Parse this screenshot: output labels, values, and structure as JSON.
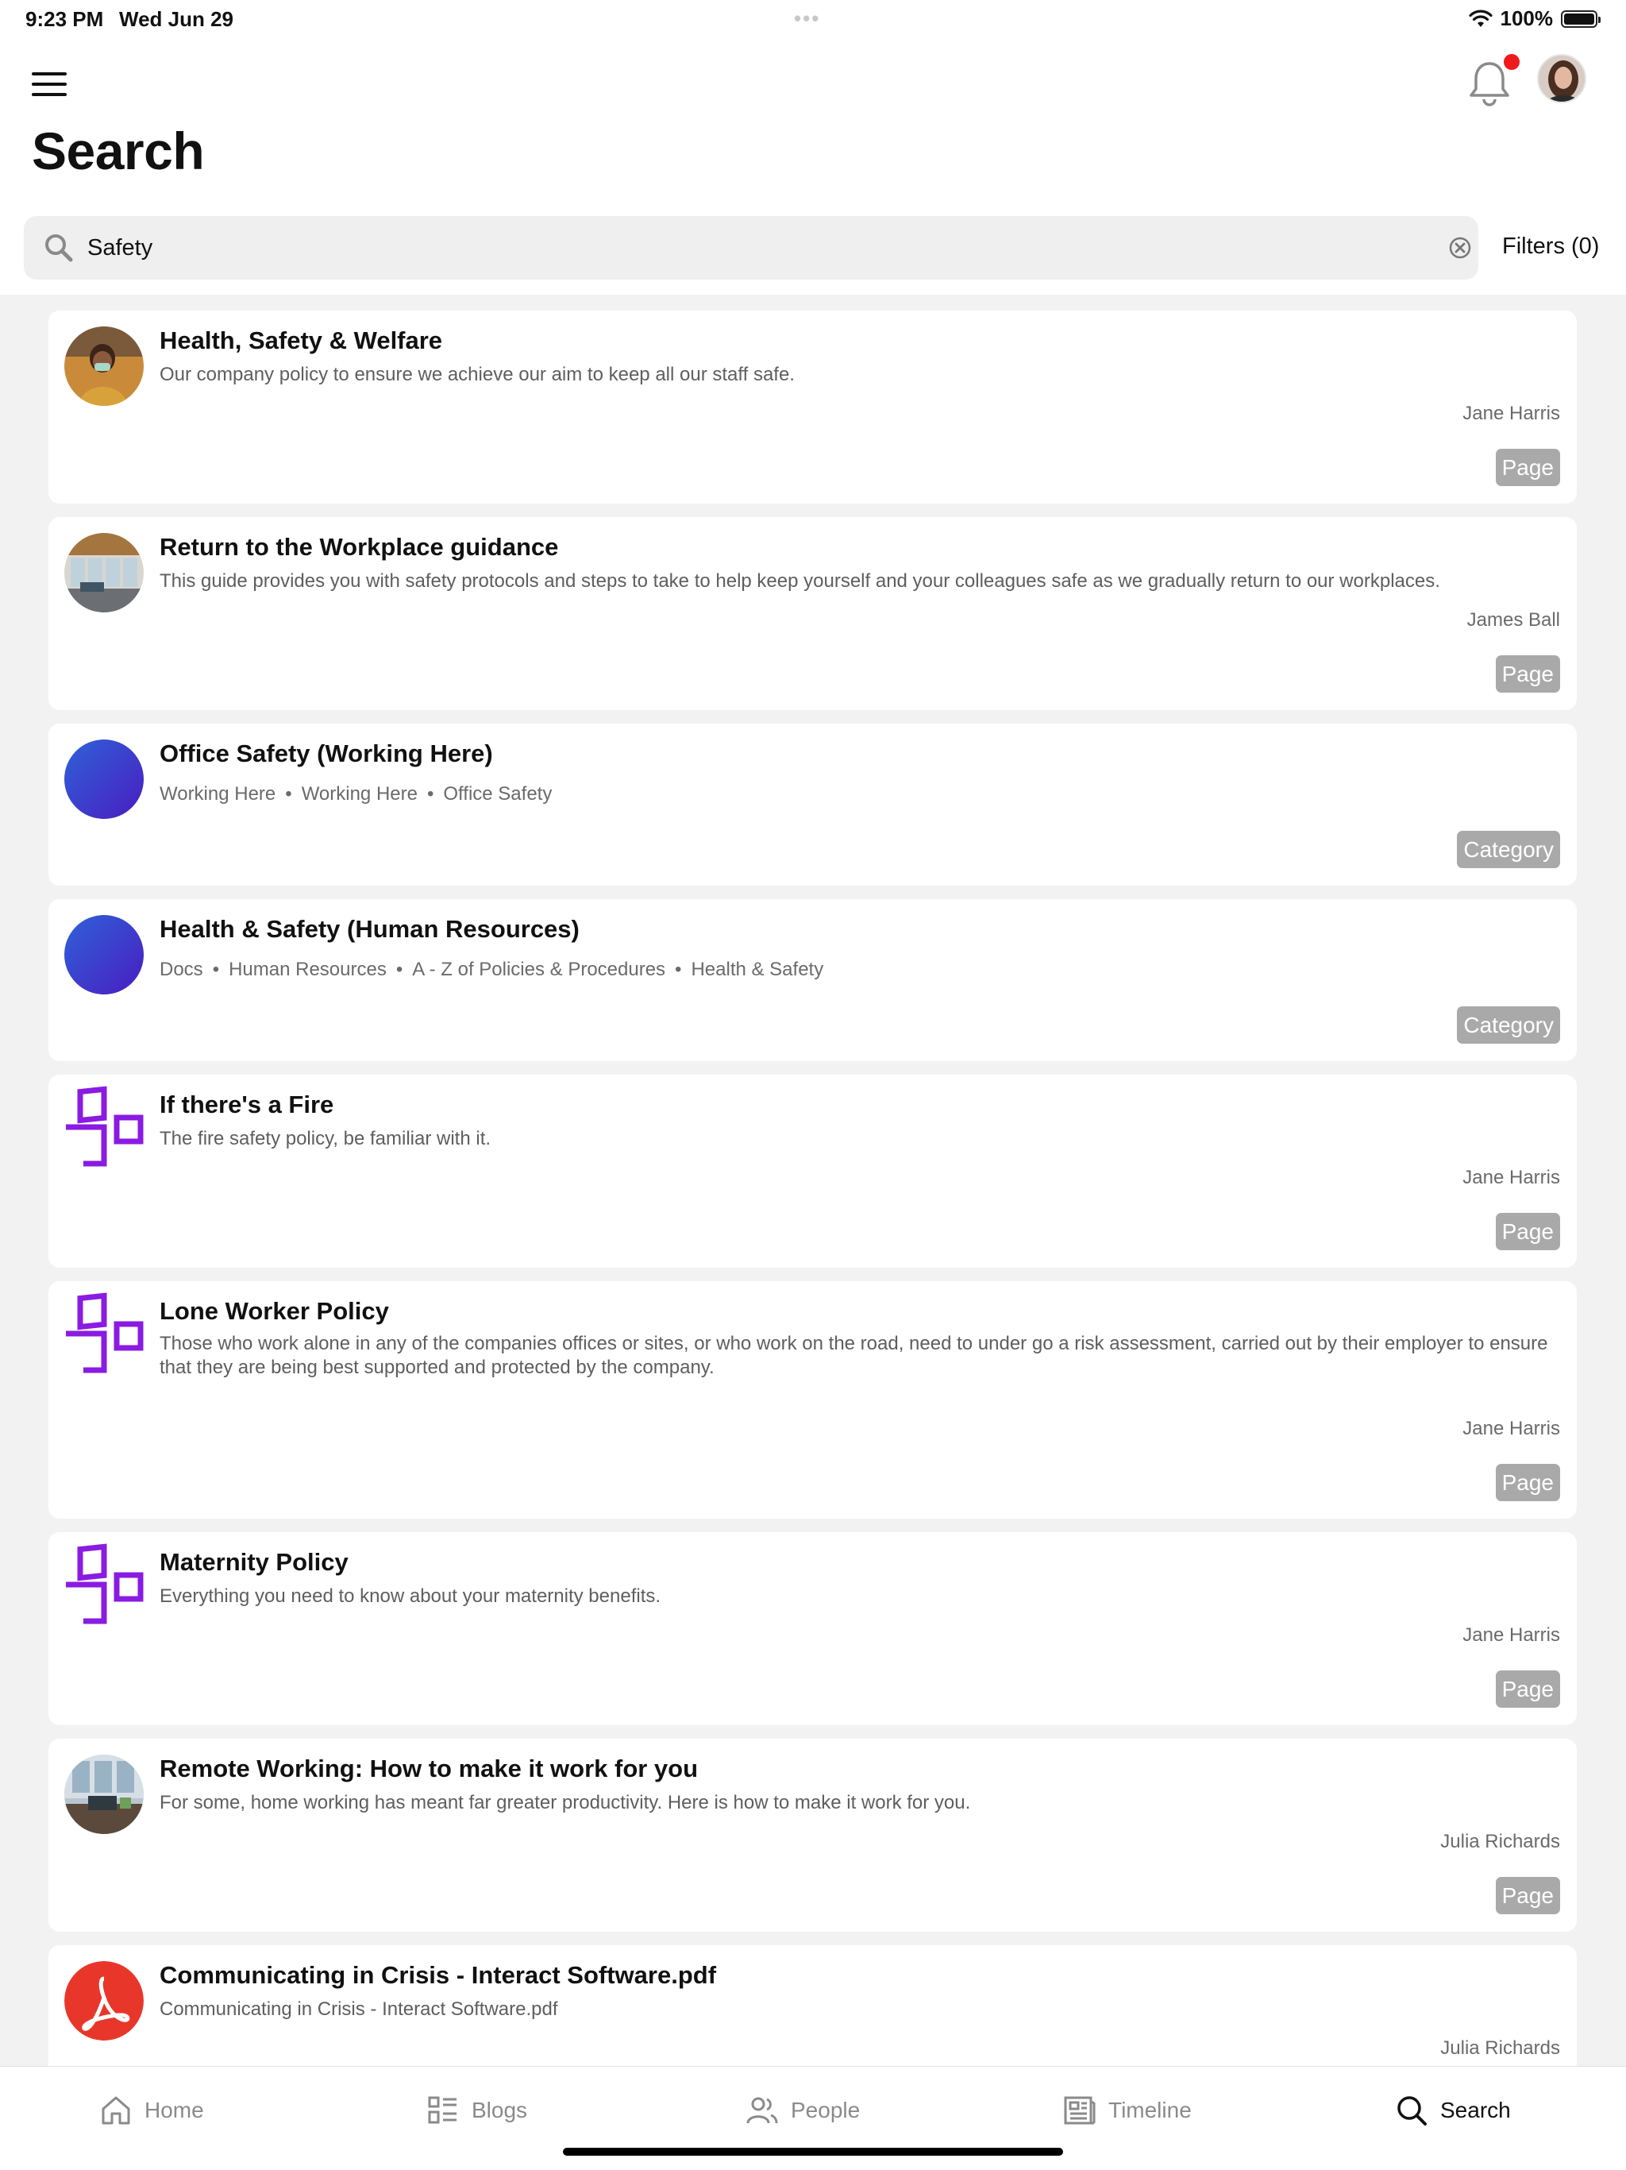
{
  "status": {
    "time": "9:23 PM",
    "date": "Wed Jun 29",
    "battery": "100%"
  },
  "header": {
    "title": "Search"
  },
  "search": {
    "value": "Safety",
    "filters_label": "Filters (0)"
  },
  "results": [
    {
      "title": "Health, Safety & Welfare",
      "description": "Our company policy to ensure we achieve our aim to keep all our staff safe.",
      "author": "Jane Harris",
      "type": "Page",
      "thumb": "photo-person"
    },
    {
      "title": "Return to the Workplace guidance",
      "description": "This guide provides you with safety protocols and steps to take to help keep yourself and your colleagues safe as we gradually return to our workplaces.",
      "author": "James Ball",
      "type": "Page",
      "thumb": "photo-office"
    },
    {
      "title": "Office Safety (Working Here)",
      "breadcrumb": [
        "Working Here",
        "Working Here",
        "Office Safety"
      ],
      "type": "Category",
      "thumb": "blue-gradient"
    },
    {
      "title": "Health & Safety (Human Resources)",
      "breadcrumb": [
        "Docs",
        "Human Resources",
        "A - Z of Policies & Procedures",
        "Health & Safety"
      ],
      "type": "Category",
      "thumb": "blue-gradient"
    },
    {
      "title": "If there's a Fire",
      "description": "The fire safety policy, be familiar with it.",
      "author": "Jane Harris",
      "type": "Page",
      "thumb": "interact-logo"
    },
    {
      "title": "Lone Worker Policy",
      "description": "Those who work alone in any of the companies offices or sites, or who work on the road, need to under go a risk assessment, carried out by their employer to ensure that they are being best supported and protected by the company.",
      "author": "Jane Harris",
      "type": "Page",
      "thumb": "interact-logo"
    },
    {
      "title": "Maternity Policy",
      "description": "Everything you need to know about your maternity benefits.",
      "author": "Jane Harris",
      "type": "Page",
      "thumb": "interact-logo"
    },
    {
      "title": "Remote Working: How to make it work for you",
      "description": "For some, home working has meant far greater productivity. Here is how to make it work for you.",
      "author": "Julia Richards",
      "type": "Page",
      "thumb": "photo-window"
    },
    {
      "title": "Communicating in Crisis - Interact Software.pdf",
      "description": "Communicating in Crisis - Interact Software.pdf",
      "author": "Julia Richards",
      "thumb": "pdf-icon"
    }
  ],
  "tabs": [
    {
      "label": "Home",
      "icon": "home-icon"
    },
    {
      "label": "Blogs",
      "icon": "blogs-icon"
    },
    {
      "label": "People",
      "icon": "people-icon"
    },
    {
      "label": "Timeline",
      "icon": "timeline-icon"
    },
    {
      "label": "Search",
      "icon": "search-icon",
      "active": true
    }
  ],
  "colors": {
    "badge": "#a9a9a9",
    "accent_purple": "#8a1be2",
    "notification": "#f0191c",
    "pdf_red": "#e8372a",
    "category_blue": "#3a30c8"
  }
}
